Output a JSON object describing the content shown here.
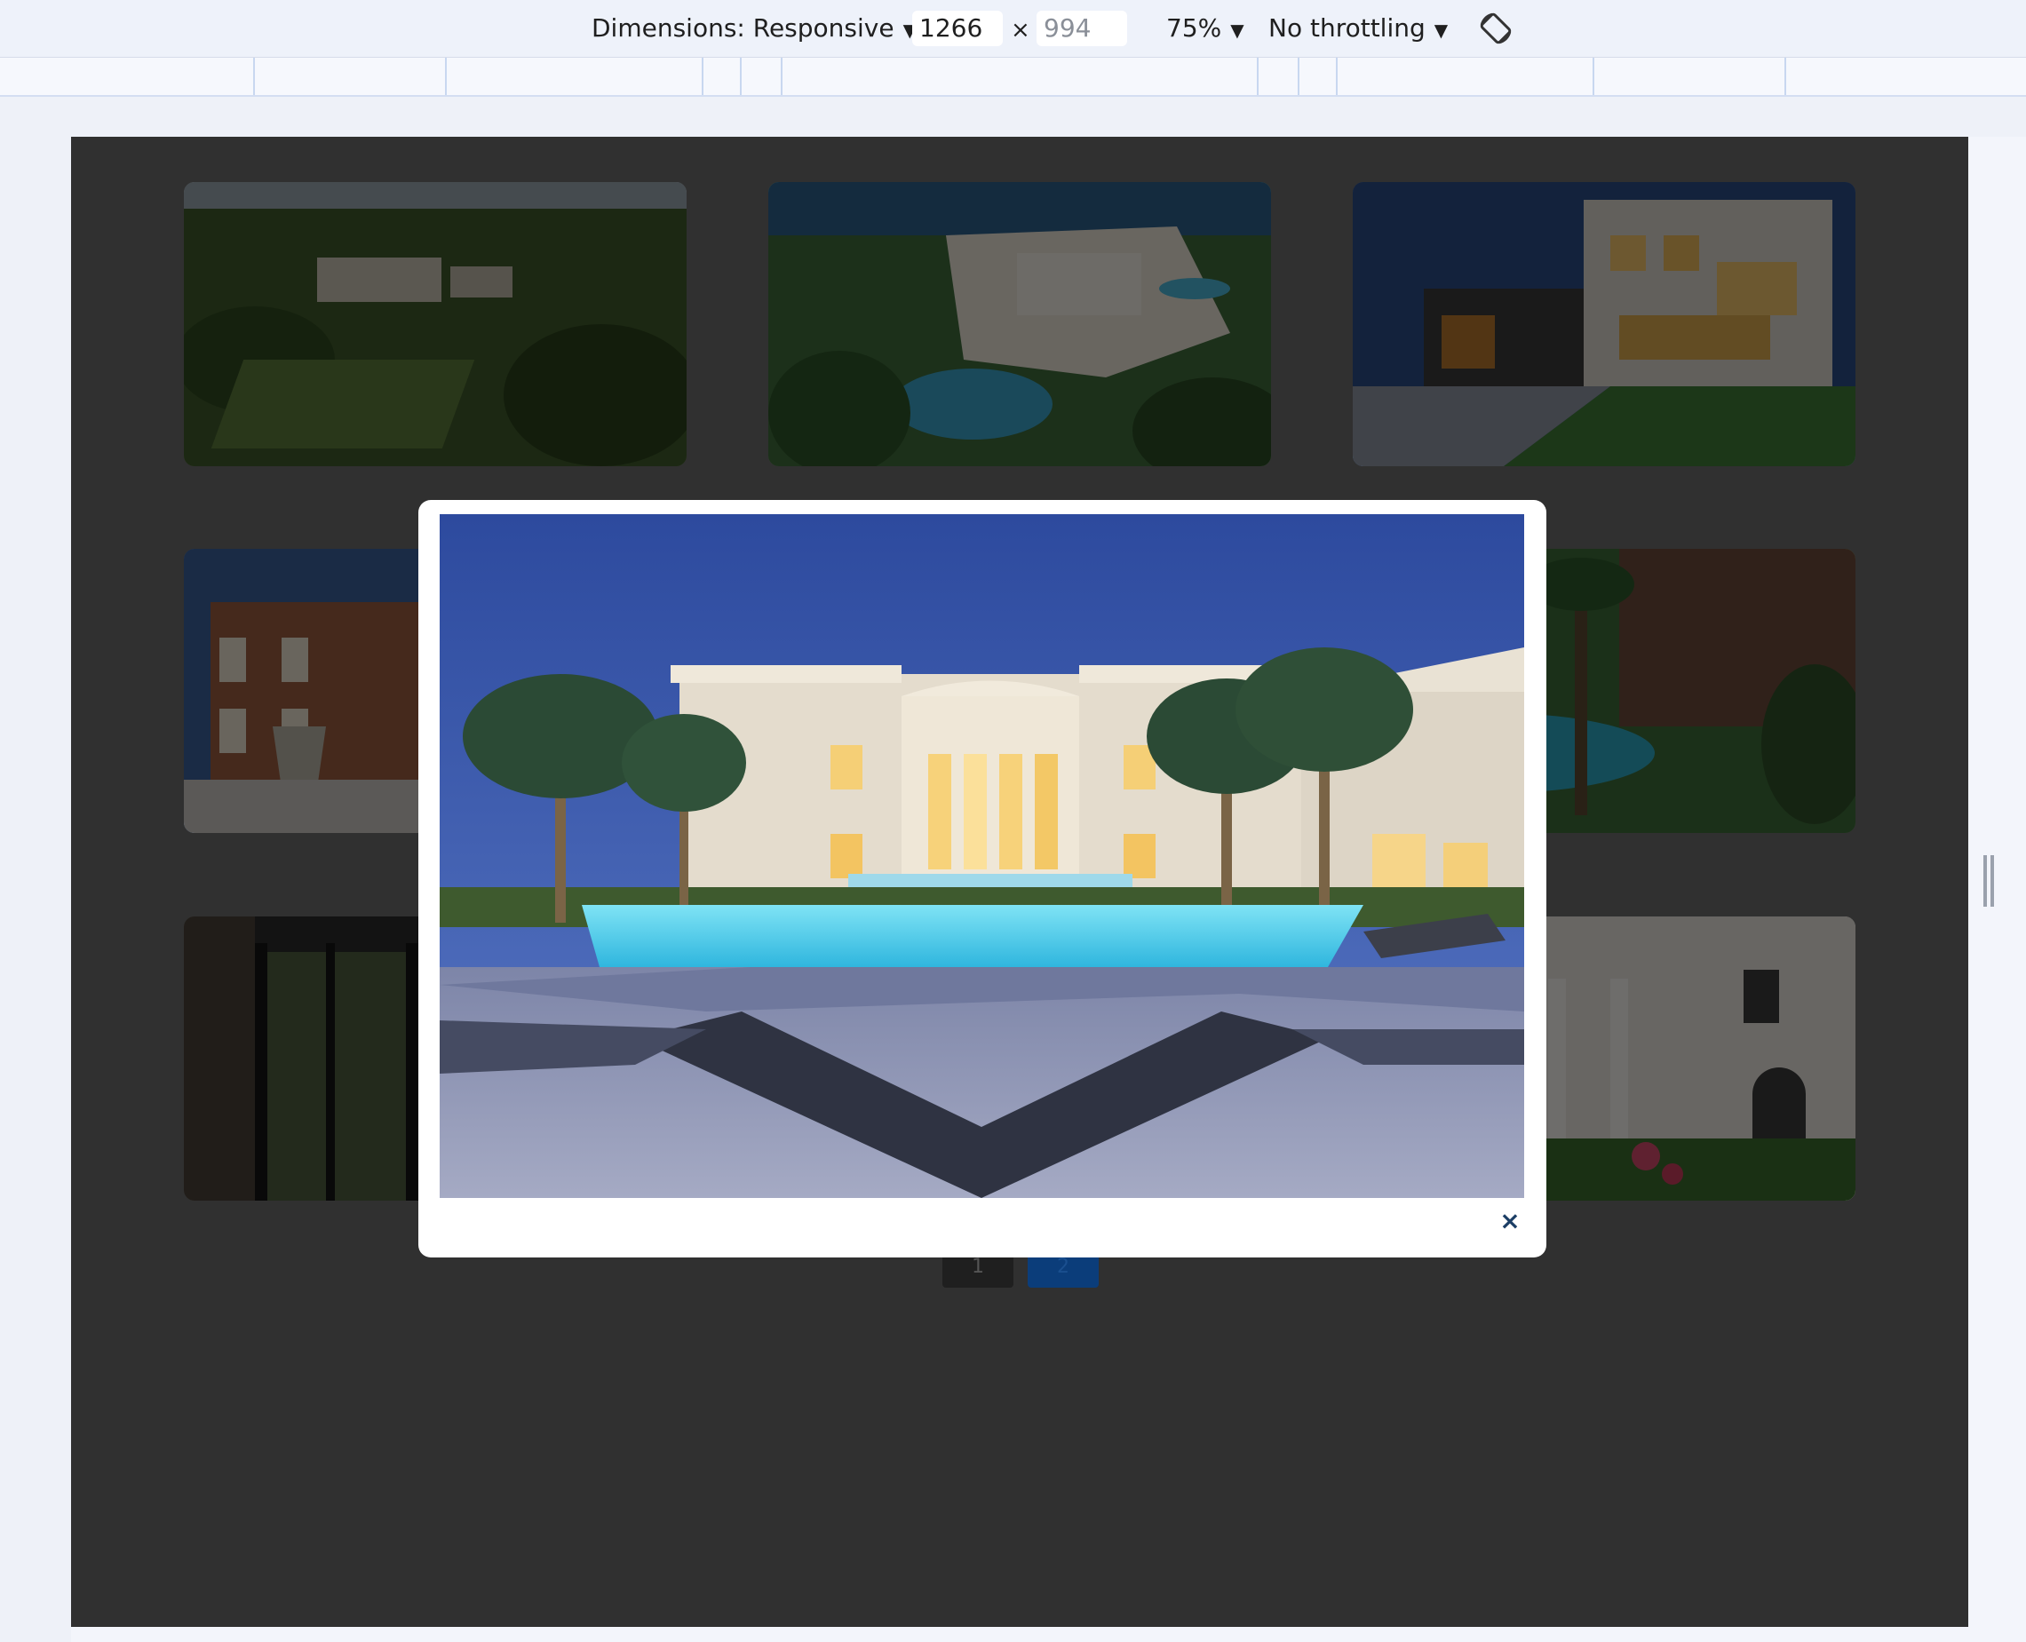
{
  "devtools": {
    "dimensions_label": "Dimensions: Responsive",
    "width_value": "1266",
    "times_symbol": "×",
    "height_placeholder": "994",
    "zoom_label": "75%",
    "throttling_label": "No throttling",
    "caret": "▼"
  },
  "gallery": {
    "cards": [
      {
        "scene": "estate-aerial"
      },
      {
        "scene": "mansion-pool-aerial"
      },
      {
        "scene": "modern-villa-night"
      },
      {
        "scene": "brick-manor-fountain"
      },
      {
        "scene": "hidden"
      },
      {
        "scene": "garden-pool"
      },
      {
        "scene": "glass-interior"
      },
      {
        "scene": "hidden"
      },
      {
        "scene": "white-classical-facade"
      }
    ],
    "pager": {
      "page1": "1",
      "page2": "2"
    }
  },
  "modal": {
    "image_scene": "villa-pool-night",
    "close_icon": "×"
  },
  "colors": {
    "overlay": "#303030",
    "modal_bg": "#ffffff",
    "close_color": "#1d3f66",
    "pager_active": "#0b3d7a"
  }
}
